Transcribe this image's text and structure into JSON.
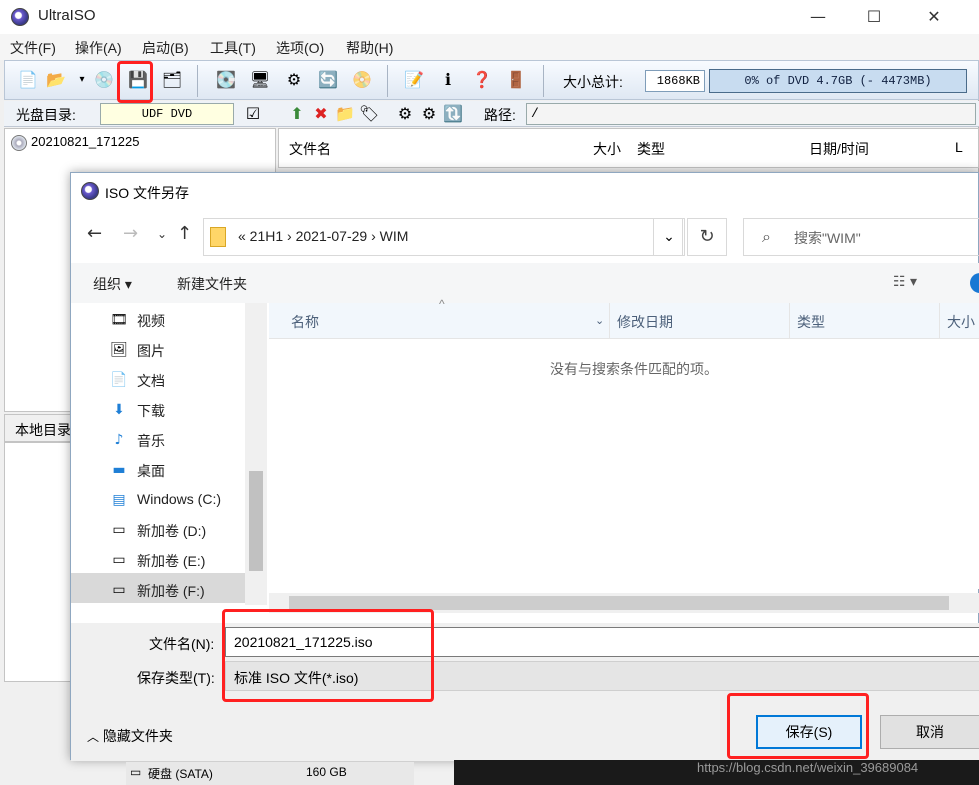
{
  "app": {
    "title": "UltraISO",
    "window_buttons": [
      "—",
      "☐",
      "✕"
    ]
  },
  "menu": [
    "文件(F)",
    "操作(A)",
    "启动(B)",
    "工具(T)",
    "选项(O)",
    "帮助(H)"
  ],
  "toolbar": {
    "size_total_label": "大小总计:",
    "size_total_value": "1868KB",
    "capacity_text": "0% of DVD 4.7GB (- 4473MB)",
    "capacity_percent": 0
  },
  "disc_row": {
    "label": "光盘目录:",
    "volume_name": "UDF DVD",
    "path_label": "路径:",
    "path_value": "/"
  },
  "left_tree": {
    "item": "20210821_171225"
  },
  "local_header": "本地目录",
  "file_columns": [
    "文件名",
    "大小",
    "类型",
    "日期/时间",
    "L"
  ],
  "dialog": {
    "title": "ISO 文件另存",
    "breadcrumbs": "«  21H1  ›  2021-07-29  ›  WIM",
    "search_placeholder": "搜索\"WIM\"",
    "organize": "组织 ▾",
    "new_folder": "新建文件夹",
    "nav_items": [
      "视频",
      "图片",
      "文档",
      "下载",
      "音乐",
      "桌面",
      "Windows (C:)",
      "新加卷 (D:)",
      "新加卷 (E:)",
      "新加卷 (F:)"
    ],
    "nav_icons": [
      "video-icon",
      "picture-icon",
      "document-icon",
      "download-icon",
      "music-icon",
      "desktop-icon",
      "drive-c-icon",
      "drive-d-icon",
      "drive-e-icon",
      "drive-f-icon"
    ],
    "columns": [
      "名称",
      "修改日期",
      "类型",
      "大小"
    ],
    "empty_message": "没有与搜索条件匹配的项。",
    "filename_label": "文件名(N):",
    "filename_value": "20210821_171225.iso",
    "filetype_label": "保存类型(T):",
    "filetype_value": "标准 ISO 文件(*.iso)",
    "hide_folders": "隐藏文件夹",
    "save": "保存(S)",
    "cancel": "取消"
  },
  "disk_row": {
    "name": "硬盘 (SATA)",
    "size": "160 GB"
  },
  "watermark": "https://blog.csdn.net/weixin_39689084",
  "colors": {
    "accent": "#0078d7",
    "annotation": "#ff2020"
  }
}
